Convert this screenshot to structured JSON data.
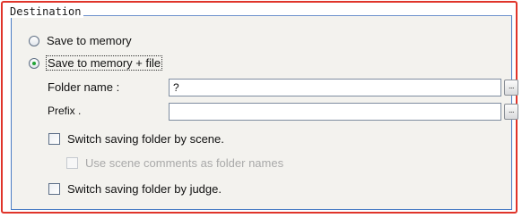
{
  "group": {
    "title": "Destination"
  },
  "options": {
    "save_memory_label": "Save to memory",
    "save_memory_file_label": "Save to memory + file"
  },
  "folder": {
    "label": "Folder name :",
    "value": "?",
    "browse_label": "..."
  },
  "prefix": {
    "label": "Prefix .",
    "value": "",
    "browse_label": "..."
  },
  "checks": {
    "scene_label": "Switch saving folder by scene.",
    "scene_comments_label": "Use scene comments as folder names",
    "judge_label": "Switch saving folder by judge."
  }
}
